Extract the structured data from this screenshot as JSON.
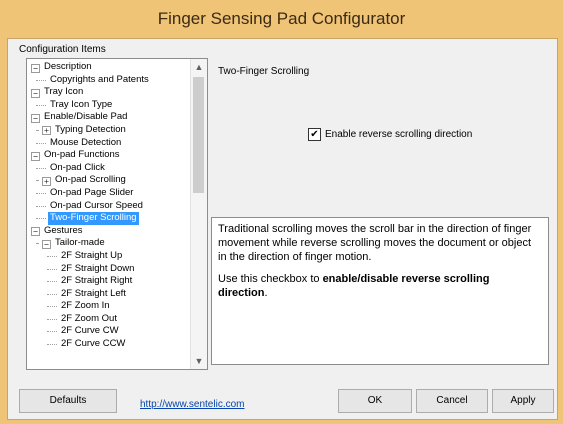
{
  "window": {
    "title": "Finger Sensing Pad Configurator"
  },
  "left_panel": {
    "label": "Configuration Items"
  },
  "tree": [
    {
      "label": "Description",
      "level": 0,
      "expander": "minus"
    },
    {
      "label": "Copyrights and Patents",
      "level": 1
    },
    {
      "label": "Tray Icon",
      "level": 0,
      "expander": "minus"
    },
    {
      "label": "Tray Icon Type",
      "level": 1
    },
    {
      "label": "Enable/Disable Pad",
      "level": 0,
      "expander": "minus"
    },
    {
      "label": "Typing Detection",
      "level": 1,
      "expander": "plus"
    },
    {
      "label": "Mouse Detection",
      "level": 1
    },
    {
      "label": "On-pad Functions",
      "level": 0,
      "expander": "minus"
    },
    {
      "label": "On-pad Click",
      "level": 1
    },
    {
      "label": "On-pad Scrolling",
      "level": 1,
      "expander": "plus"
    },
    {
      "label": "On-pad Page Slider",
      "level": 1
    },
    {
      "label": "On-pad Cursor Speed",
      "level": 1
    },
    {
      "label": "Two-Finger Scrolling",
      "level": 1,
      "selected": true
    },
    {
      "label": "Gestures",
      "level": 0,
      "expander": "minus"
    },
    {
      "label": "Tailor-made",
      "level": 1,
      "expander": "minus"
    },
    {
      "label": "2F Straight Up",
      "level": 2
    },
    {
      "label": "2F Straight Down",
      "level": 2
    },
    {
      "label": "2F Straight Right",
      "level": 2
    },
    {
      "label": "2F Straight Left",
      "level": 2
    },
    {
      "label": "2F Zoom In",
      "level": 2
    },
    {
      "label": "2F Zoom Out",
      "level": 2
    },
    {
      "label": "2F Curve CW",
      "level": 2
    },
    {
      "label": "2F Curve CCW",
      "level": 2
    }
  ],
  "right_panel": {
    "title": "Two-Finger Scrolling",
    "checkbox_label": "Enable reverse scrolling direction",
    "checkbox_checked": true,
    "desc_para1": "Traditional scrolling moves the scroll bar in the direction of finger movement while reverse scrolling moves the document or object in the direction of finger motion.",
    "desc_para2_prefix": "Use this checkbox to ",
    "desc_para2_bold": "enable/disable reverse scrolling direction",
    "desc_para2_suffix": "."
  },
  "footer": {
    "defaults": "Defaults",
    "link": "http://www.sentelic.com",
    "ok": "OK",
    "cancel": "Cancel",
    "apply": "Apply"
  },
  "icons": {
    "scroll_up": "chevron-up-icon",
    "scroll_down": "chevron-down-icon",
    "check": "checkmark-icon"
  },
  "colors": {
    "titlebar": "#f0c477",
    "selection": "#3399ff",
    "link": "#0645ad"
  }
}
